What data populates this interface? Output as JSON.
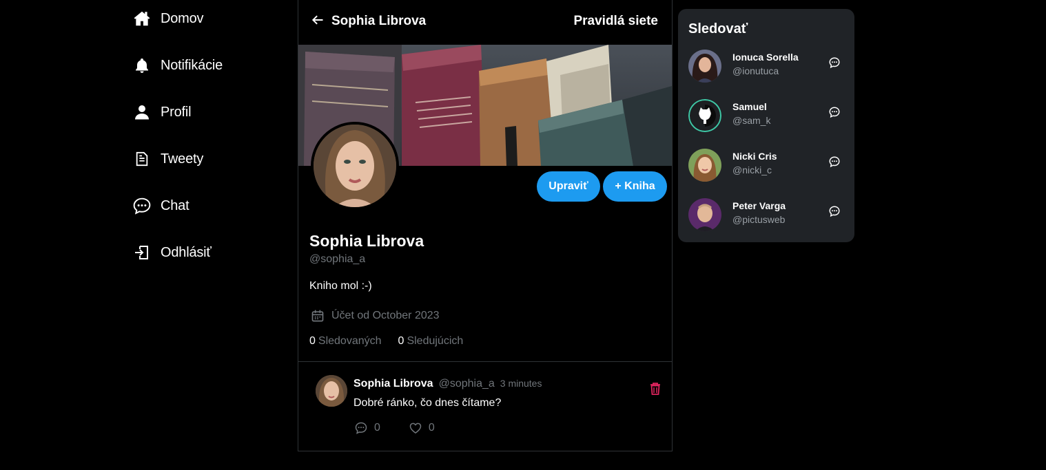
{
  "nav": {
    "items": [
      {
        "label": "Domov",
        "icon": "home-icon"
      },
      {
        "label": "Notifikácie",
        "icon": "bell-icon"
      },
      {
        "label": "Profil",
        "icon": "user-icon"
      },
      {
        "label": "Tweety",
        "icon": "document-icon"
      },
      {
        "label": "Chat",
        "icon": "chat-icon"
      },
      {
        "label": "Odhlásiť",
        "icon": "logout-icon"
      }
    ]
  },
  "header": {
    "title": "Sophia Librova",
    "rules_label": "Pravidlá siete"
  },
  "profile": {
    "name": "Sophia Librova",
    "handle": "@sophia_a",
    "bio": "Kniho mol :-)",
    "joined": "Účet od October 2023",
    "following_count": "0",
    "following_label": "Sledovaných",
    "followers_count": "0",
    "followers_label": "Sledujúcich",
    "edit_label": "Upraviť",
    "add_book_label": "+ Kniha"
  },
  "tweet": {
    "author": "Sophia Librova",
    "handle": "@sophia_a",
    "time": "3 minutes",
    "text": "Dobré ránko, čo dnes čítame?",
    "comments": "0",
    "likes": "0"
  },
  "follow": {
    "title": "Sledovať",
    "users": [
      {
        "name": "Ionuca Sorella",
        "handle": "@ionutuca"
      },
      {
        "name": "Samuel",
        "handle": "@sam_k"
      },
      {
        "name": "Nicki Cris",
        "handle": "@nicki_c"
      },
      {
        "name": "Peter Varga",
        "handle": "@pictusweb"
      }
    ]
  },
  "colors": {
    "accent": "#1d9bf0",
    "panel": "#202327",
    "muted": "#71767b",
    "delete": "#e0245e"
  }
}
